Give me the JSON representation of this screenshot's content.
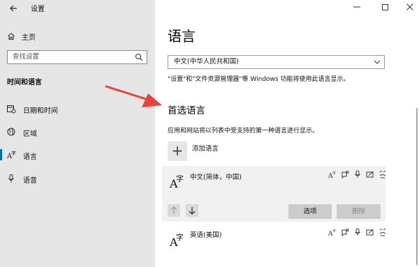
{
  "window": {
    "app_title": "设置",
    "back_icon": "back-arrow-icon",
    "minimize_icon": "minimize-icon",
    "maximize_icon": "maximize-icon",
    "close_icon": "close-icon"
  },
  "sidebar": {
    "home_label": "主页",
    "search_placeholder": "查找设置",
    "section_title": "时间和语言",
    "items": [
      {
        "label": "日期和时间",
        "icon": "calendar-clock-icon",
        "active": false
      },
      {
        "label": "区域",
        "icon": "globe-icon",
        "active": false
      },
      {
        "label": "语言",
        "icon": "language-icon",
        "active": true
      },
      {
        "label": "语音",
        "icon": "microphone-icon",
        "active": false
      }
    ]
  },
  "main": {
    "page_title": "语言",
    "display_language": "中文(中华人民共和国)",
    "display_note": "\"设置\"和\"文件资源管理器\"等 Windows 功能将使用此语言显示。",
    "preferred_title": "首选语言",
    "preferred_desc": "应用和网站将以列表中受支持的第一种语言进行显示。",
    "add_language_label": "添加语言",
    "languages": [
      {
        "name": "中文(简体，中国)",
        "glyph_big": "A",
        "glyph_small": "字"
      },
      {
        "name": "英语(美国)",
        "glyph_big": "A",
        "glyph_small": "字"
      }
    ],
    "options_label": "选项",
    "remove_label": "删除"
  },
  "colors": {
    "sidebar_bg": "#e6e6e6",
    "accent": "#0067c0",
    "annotation_arrow": "#e8423a"
  }
}
